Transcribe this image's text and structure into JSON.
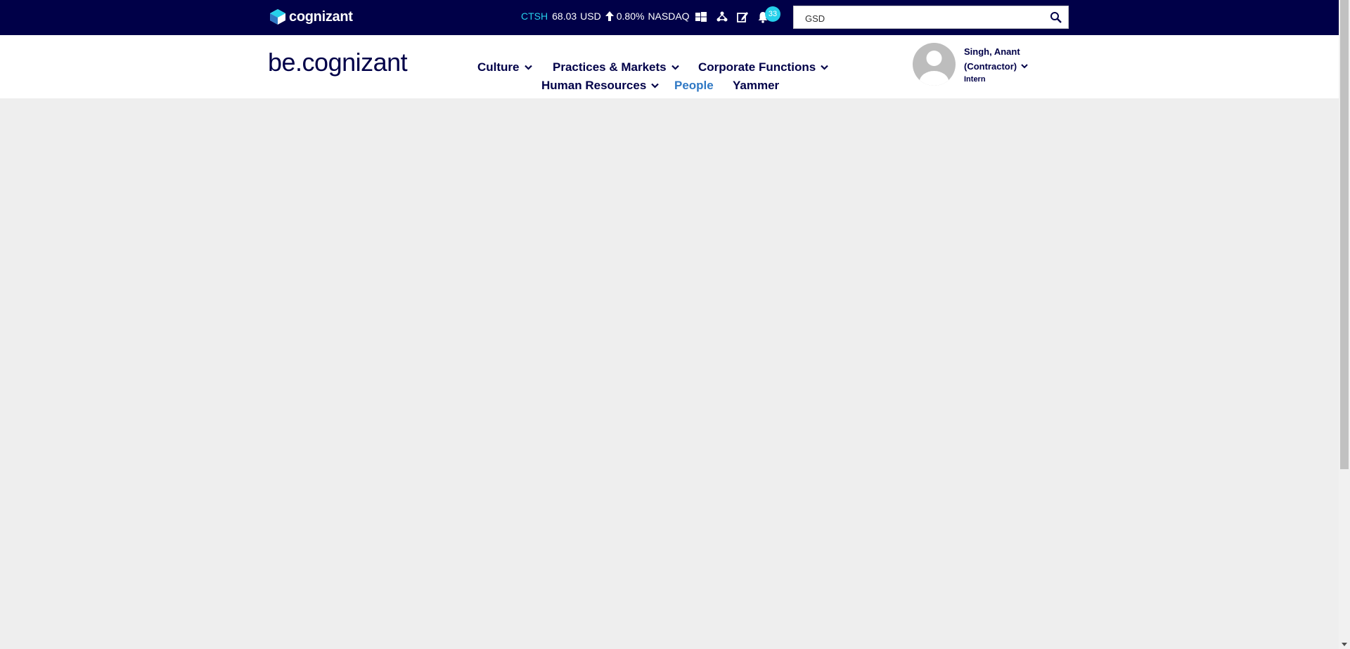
{
  "topbar": {
    "brand": "cognizant",
    "stock": {
      "symbol": "CTSH",
      "price": "68.03",
      "currency": "USD",
      "direction_icon": "arrow-up-icon",
      "change": "0.80%",
      "exchange": "NASDAQ"
    },
    "icons": [
      "windows-icon",
      "network-icon",
      "edit-icon",
      "bell-icon"
    ],
    "notification_count": "33",
    "search": {
      "value": "GSD",
      "placeholder": ""
    }
  },
  "header": {
    "site_logo": "be.cognizant",
    "nav": {
      "culture": "Culture",
      "practices": "Practices & Markets",
      "corporate": "Corporate Functions",
      "hr": "Human Resources",
      "people": "People",
      "yammer": "Yammer"
    },
    "user": {
      "name_line1": "Singh, Anant",
      "name_line2": "(Contractor)",
      "role": "Intern"
    }
  },
  "colors": {
    "navy": "#000048",
    "accent_cyan": "#26d0ea",
    "active_blue": "#2f78c4",
    "page_bg": "#eeeeee"
  }
}
